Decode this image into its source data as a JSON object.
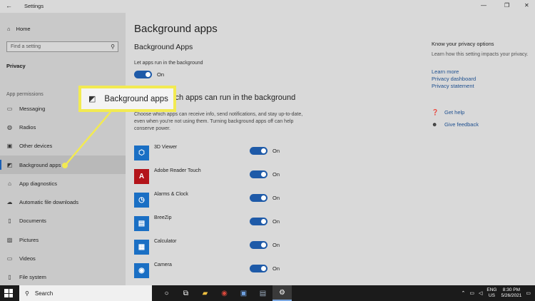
{
  "window": {
    "title": "Settings",
    "controls": [
      "—",
      "❐",
      "✕"
    ]
  },
  "sidebar": {
    "home_label": "Home",
    "search_placeholder": "Find a setting",
    "section_title": "Privacy",
    "group_label": "App permissions",
    "items": [
      {
        "label": "Messaging",
        "icon": "message-icon",
        "glyph": "▭"
      },
      {
        "label": "Radios",
        "icon": "radio-icon",
        "glyph": "◍"
      },
      {
        "label": "Other devices",
        "icon": "devices-icon",
        "glyph": "▣"
      },
      {
        "label": "Background apps",
        "icon": "background-apps-icon",
        "glyph": "◩"
      },
      {
        "label": "App diagnostics",
        "icon": "diagnostics-icon",
        "glyph": "⌂"
      },
      {
        "label": "Automatic file downloads",
        "icon": "cloud-download-icon",
        "glyph": "☁"
      },
      {
        "label": "Documents",
        "icon": "document-icon",
        "glyph": "▯"
      },
      {
        "label": "Pictures",
        "icon": "picture-icon",
        "glyph": "▨"
      },
      {
        "label": "Videos",
        "icon": "video-icon",
        "glyph": "▭"
      },
      {
        "label": "File system",
        "icon": "file-icon",
        "glyph": "▯"
      }
    ],
    "active_item": "Background apps"
  },
  "main": {
    "page_title": "Background apps",
    "section_title": "Background Apps",
    "let_apps_label": "Let apps run in the background",
    "master_toggle_state": "On",
    "choose_title": "Choose which apps can run in the background",
    "choose_desc": "Choose which apps can receive info, send notifications, and stay up-to-date, even when you're not using them. Turning background apps off can help conserve power.",
    "apps": [
      {
        "name": "3D Viewer",
        "state": "On",
        "icon": "cube-icon",
        "glyph": "⬡",
        "color": "#1a6fc4"
      },
      {
        "name": "Adobe Reader Touch",
        "state": "On",
        "icon": "adobe-reader-icon",
        "glyph": "A",
        "color": "#b3141a"
      },
      {
        "name": "Alarms & Clock",
        "state": "On",
        "icon": "clock-icon",
        "glyph": "◷",
        "color": "#1a6fc4"
      },
      {
        "name": "BreeZip",
        "state": "On",
        "icon": "breezip-icon",
        "glyph": "▤",
        "color": "#1a6fc4"
      },
      {
        "name": "Calculator",
        "state": "On",
        "icon": "calculator-icon",
        "glyph": "▦",
        "color": "#1a6fc4"
      },
      {
        "name": "Camera",
        "state": "On",
        "icon": "camera-icon",
        "glyph": "◉",
        "color": "#1a6fc4"
      }
    ]
  },
  "right_panel": {
    "title": "Know your privacy options",
    "desc": "Learn how this setting impacts your privacy.",
    "links": [
      "Learn more",
      "Privacy dashboard",
      "Privacy statement"
    ],
    "help_label": "Get help",
    "feedback_label": "Give feedback"
  },
  "callout": {
    "label": "Background apps",
    "highlight_color": "#f2ea52"
  },
  "taskbar": {
    "search_label": "Search",
    "lang_line1": "ENG",
    "lang_line2": "US",
    "time": "8:30 PM",
    "date": "5/26/2021"
  }
}
